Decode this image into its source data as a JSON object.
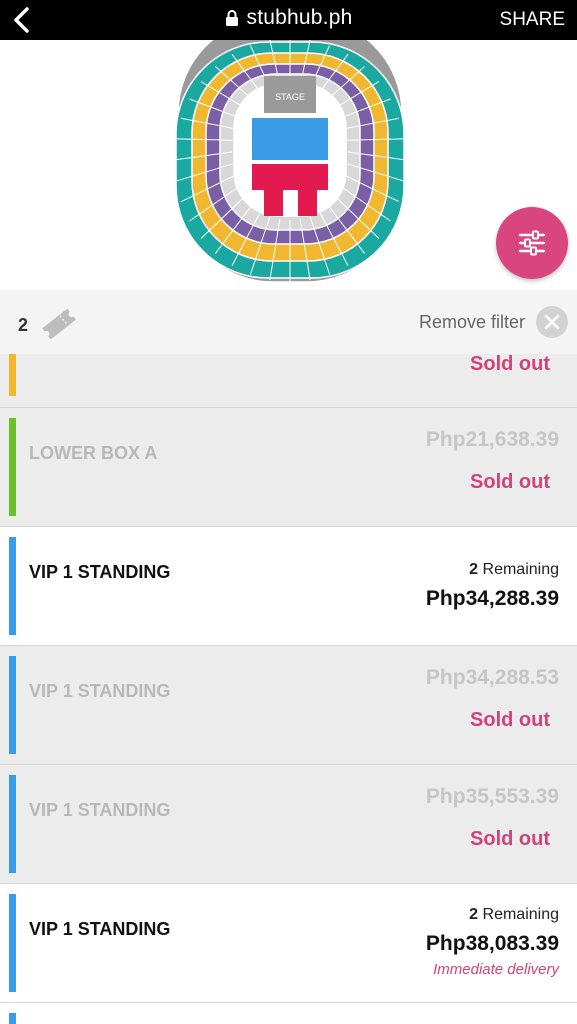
{
  "browser": {
    "url": "stubhub.ph",
    "share_label": "SHARE"
  },
  "seatmap": {
    "stage_label": "STAGE",
    "colors": {
      "teal": "#1aa8a0",
      "yellow": "#f0b830",
      "purple": "#7b5fa6",
      "gray": "#9a9a9a",
      "blue": "#3a9be6",
      "red": "#e31a4f",
      "light": "#d8d8d8"
    }
  },
  "filter": {
    "quantity": "2",
    "remove_label": "Remove filter"
  },
  "listings": [
    {
      "name": "",
      "price": "",
      "status": "Sold out",
      "remaining_count": "",
      "remaining_label": "",
      "delivery": "",
      "sold_out": true,
      "color": "#f0b830"
    },
    {
      "name": "LOWER BOX A",
      "price": "Php21,638.39",
      "status": "Sold out",
      "remaining_count": "",
      "remaining_label": "",
      "delivery": "",
      "sold_out": true,
      "color": "#6cc12a"
    },
    {
      "name": "VIP 1 STANDING",
      "price": "Php34,288.39",
      "status": "",
      "remaining_count": "2",
      "remaining_label": "Remaining",
      "delivery": "",
      "sold_out": false,
      "color": "#3a9be6"
    },
    {
      "name": "VIP 1 STANDING",
      "price": "Php34,288.53",
      "status": "Sold out",
      "remaining_count": "",
      "remaining_label": "",
      "delivery": "",
      "sold_out": true,
      "color": "#3a9be6"
    },
    {
      "name": "VIP 1 STANDING",
      "price": "Php35,553.39",
      "status": "Sold out",
      "remaining_count": "",
      "remaining_label": "",
      "delivery": "",
      "sold_out": true,
      "color": "#3a9be6"
    },
    {
      "name": "VIP 1 STANDING",
      "price": "Php38,083.39",
      "status": "",
      "remaining_count": "2",
      "remaining_label": "Remaining",
      "delivery": "Immediate delivery",
      "sold_out": false,
      "color": "#3a9be6"
    },
    {
      "name": "",
      "price": "",
      "status": "",
      "remaining_count": "",
      "remaining_label": "",
      "delivery": "",
      "sold_out": false,
      "color": "#3a9be6"
    }
  ]
}
